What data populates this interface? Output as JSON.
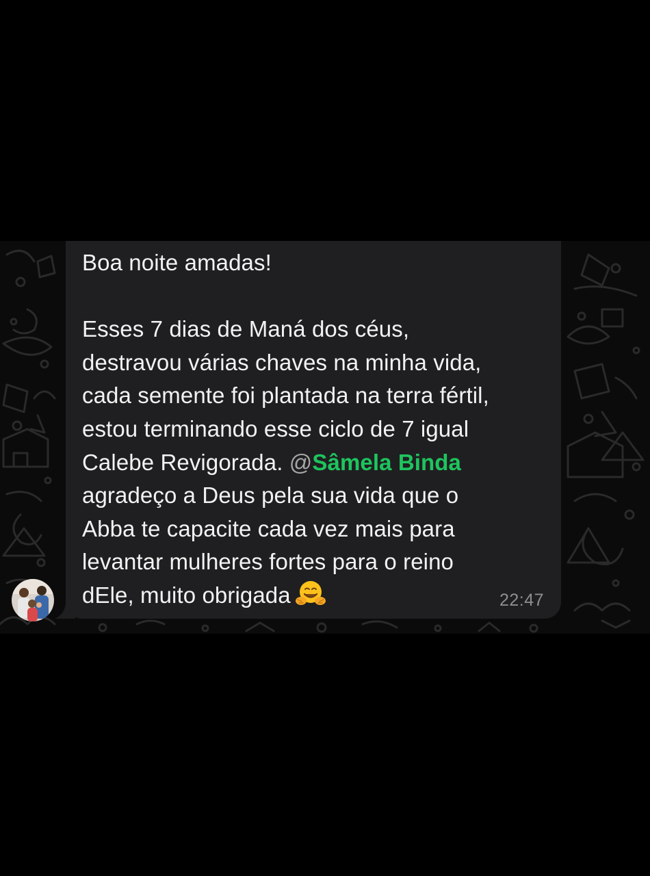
{
  "message": {
    "line_1": "Boa noite amadas!",
    "line_2": "",
    "line_3": "Esses 7 dias de Maná dos céus,",
    "line_4": "destravou várias chaves na minha vida,",
    "line_5": "cada semente foi plantada na terra fértil,",
    "line_6": "estou terminando esse ciclo de 7 igual",
    "line_7_prefix": "Calebe Revigorada. ",
    "mention_at": "@",
    "mention_name": "Sâmela Binda",
    "line_8": "agradeço a Deus pela sua vida que o",
    "line_9": "Abba te capacite cada vez mais para",
    "line_10": "levantar mulheres fortes para o reino",
    "line_11": "dEle, muito obrigada",
    "emoji": "hugging-face-emoji",
    "timestamp": "22:47"
  },
  "colors": {
    "background": "#000000",
    "chat_wallpaper": "#0b0b0b",
    "bubble": "#1f1f21",
    "text": "#f2f2f2",
    "mention": "#1ec45e",
    "timestamp": "#8e8e92"
  },
  "sender": {
    "avatar_icon": "family-photo-avatar"
  }
}
